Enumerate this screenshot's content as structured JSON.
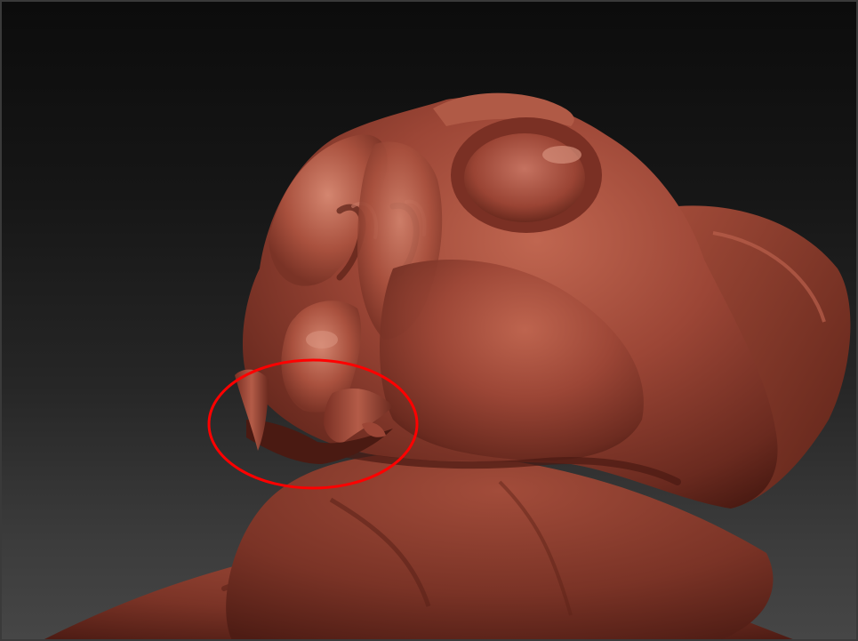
{
  "viewport": {
    "background_top": "#0c0c0c",
    "background_bottom": "#464646",
    "border_color": "#3a3a3a"
  },
  "model": {
    "material_base": "#9a4434",
    "material_highlight": "#c97a66",
    "material_shadow": "#4a1a12"
  },
  "annotation": {
    "shape": "ellipse",
    "stroke_color": "#ff0000",
    "target": "fangs-and-mouth"
  }
}
